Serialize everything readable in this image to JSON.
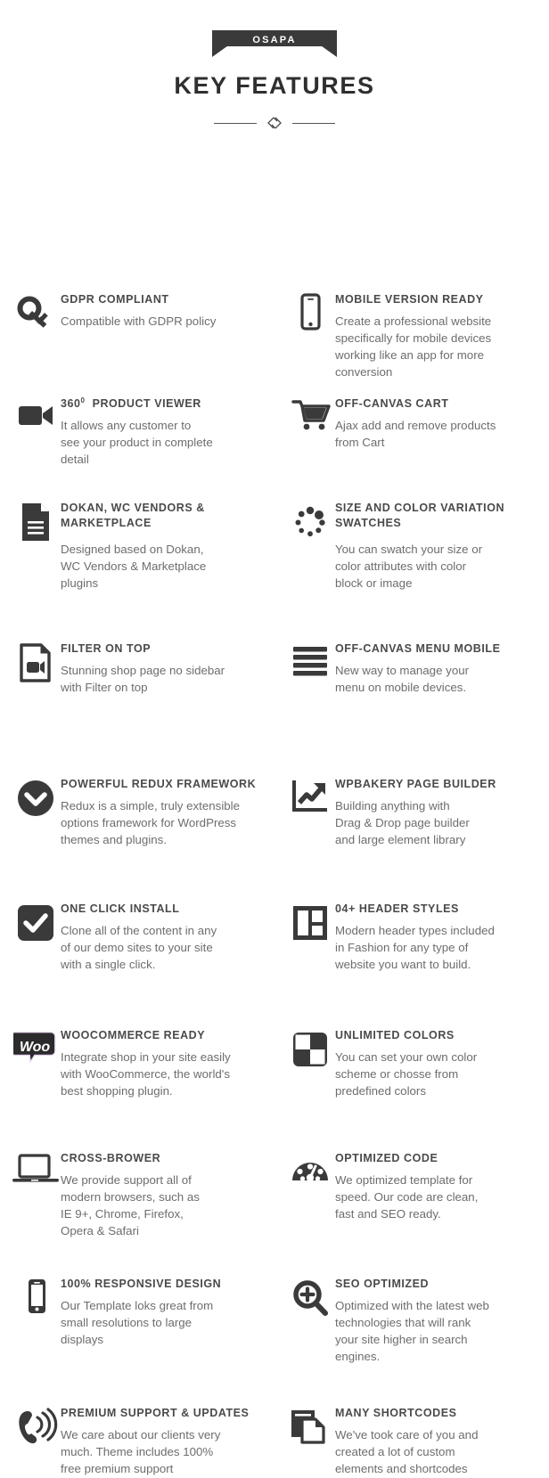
{
  "header": {
    "ribbon_label": "OSAPA",
    "title": "KEY FEATURES",
    "divider_icon": "double-diamond-ornament"
  },
  "features": [
    {
      "id": "gdpr-compliant",
      "icon": "key-icon",
      "title": "GDPR COMPLIANT",
      "desc_lines": [
        "Compatible with GDPR policy"
      ]
    },
    {
      "id": "mobile-version-ready",
      "icon": "mobile-phone-icon",
      "title": "MOBILE VERSION READY",
      "desc_lines": [
        "Create a professional website",
        "specifically for mobile devices",
        "working like an app for more",
        "conversion"
      ]
    },
    {
      "id": "360-product-viewer",
      "icon": "video-camera-icon",
      "title_prefix": "360",
      "title_sup": "0",
      "title_suffix": "PRODUCT VIEWER",
      "title": "360⁰ PRODUCT VIEWER",
      "desc_lines": [
        "It allows any customer to",
        "see your product in complete",
        "detail"
      ]
    },
    {
      "id": "off-canvas-cart",
      "icon": "shopping-cart-icon",
      "title": "OFF-CANVAS CART",
      "desc_lines": [
        "Ajax add and remove products",
        "from Cart"
      ]
    },
    {
      "id": "dokan-wc-vendors-marketplace",
      "icon": "document-lines-icon",
      "title": "DOKAN, WC VENDORS & MARKETPLACE",
      "desc_lines": [
        "Designed based on Dokan,",
        "WC Vendors & Marketplace",
        "plugins"
      ]
    },
    {
      "id": "size-and-color-variation-swatches",
      "icon": "loading-dots-circle-icon",
      "title": "SIZE AND COLOR VARIATION SWATCHES",
      "desc_lines": [
        "You can swatch your size or",
        "color attributes with color",
        "block or image"
      ]
    },
    {
      "id": "filter-on-top",
      "icon": "video-file-icon",
      "title": "FILTER ON TOP",
      "desc_lines": [
        "Stunning shop page no sidebar",
        "with Filter on top"
      ]
    },
    {
      "id": "off-canvas-menu-mobile",
      "icon": "hamburger-menu-icon",
      "title": "OFF-CANVAS MENU MOBILE",
      "desc_lines": [
        "New way to manage your",
        "menu on mobile devices."
      ]
    },
    {
      "id": "powerful-redux-framework",
      "icon": "chevron-down-circle-icon",
      "title": "POWERFUL REDUX FRAMEWORK",
      "desc_lines": [
        "Redux is a simple, truly extensible",
        "options framework for WordPress",
        "themes and plugins."
      ]
    },
    {
      "id": "wpbakery-page-builder",
      "icon": "growth-chart-icon",
      "title": "WPBAKERY PAGE BUILDER",
      "desc_lines": [
        "Building anything with",
        "Drag & Drop page builder",
        "and large element library"
      ]
    },
    {
      "id": "one-click-install",
      "icon": "checkmark-square-icon",
      "title": "ONE CLICK INSTALL",
      "desc_lines": [
        "Clone all of the content in any",
        "of our demo sites to your site",
        "with a single click."
      ]
    },
    {
      "id": "header-styles",
      "icon": "layout-grid-icon",
      "title": "04+ HEADER STYLES",
      "desc_lines": [
        "Modern header types included",
        "in Fashion for any type of",
        "website you want to build."
      ]
    },
    {
      "id": "woocommerce-ready",
      "icon": "woocommerce-logo-icon",
      "title": "WOOCOMMERCE READY",
      "desc_lines": [
        "Integrate shop in your site easily",
        "with WooCommerce, the world's",
        "best shopping plugin."
      ]
    },
    {
      "id": "unlimited-colors",
      "icon": "checkerboard-icon",
      "title": "UNLIMITED COLORS",
      "desc_lines": [
        "You can set your own color",
        "scheme or chosse from",
        "predefined colors"
      ]
    },
    {
      "id": "cross-brower",
      "icon": "laptop-icon",
      "title": "CROSS-BROWER",
      "desc_lines": [
        "We provide support all of",
        "modern browsers, such as",
        "IE 9+, Chrome, Firefox,",
        "Opera & Safari"
      ]
    },
    {
      "id": "optimized-code",
      "icon": "speedometer-icon",
      "title": "OPTIMIZED CODE",
      "desc_lines": [
        "We optimized template for",
        "speed. Our code are clean,",
        "fast and SEO ready."
      ]
    },
    {
      "id": "responsive-design",
      "icon": "smartphone-icon",
      "title": "100% RESPONSIVE DESIGN",
      "desc_lines": [
        "Our Template loks great from",
        "small resolutions to large",
        "displays"
      ]
    },
    {
      "id": "seo-optimized",
      "icon": "magnifier-plus-icon",
      "title": "SEO OPTIMIZED",
      "desc_lines": [
        "Optimized with the latest web",
        "technologies that will rank",
        "your site higher in search",
        "engines."
      ]
    },
    {
      "id": "premium-support-updates",
      "icon": "phone-ringing-icon",
      "title": "PREMIUM SUPPORT & UPDATES",
      "desc_lines": [
        "We care about our clients very",
        "much. Theme includes 100%",
        "free premium support"
      ]
    },
    {
      "id": "many-shortcodes",
      "icon": "copy-documents-icon",
      "title": "MANY SHORTCODES",
      "desc_lines": [
        "We've took care of you and",
        "created a lot of custom",
        "elements and shortcodes"
      ]
    }
  ],
  "colors": {
    "background": "#ffffff",
    "icon": "#3a3a3a",
    "title": "#4a4a4a",
    "body_text": "#6d6d6d",
    "ribbon": "#3a3a3a",
    "woocommerce_accent": "#f3eaf7"
  }
}
